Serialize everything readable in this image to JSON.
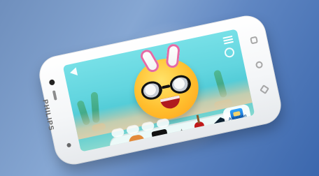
{
  "device": {
    "brand": "PHILIPS"
  },
  "app": {
    "certificate_label": "Adoption Certificate"
  },
  "icons": {
    "back": "back-arrow-icon",
    "menu": "hamburger-menu-icon",
    "settings": "settings-icon",
    "certificate": "certificate-icon",
    "hotdog": "hotdog-icon",
    "tophat": "tophat-icon",
    "sparkle": "sparkle-icon",
    "plunger": "plunger-icon",
    "gradcap": "graduation-cap-icon"
  }
}
